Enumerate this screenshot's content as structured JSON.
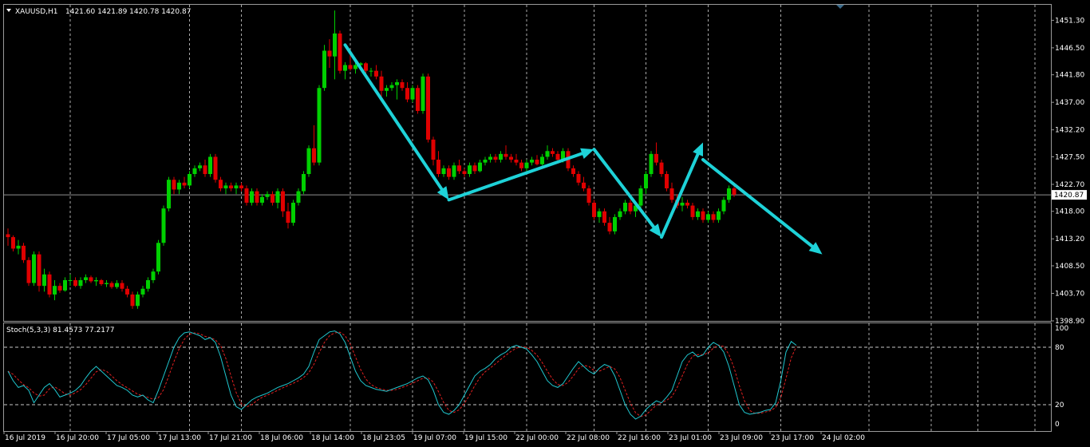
{
  "header": {
    "symbol": "XAUUSD,H1",
    "ohlc": "1421.60 1421.89 1420.78 1420.87",
    "menu_icon": "triangle-down-icon"
  },
  "indicator": {
    "label": "Stoch(5,3,3) 81.4573 77.2177"
  },
  "colors": {
    "background": "#000000",
    "bull": "#00d000",
    "bear": "#e00000",
    "grid": "#c8c8c8",
    "arrow": "#1ed2d8",
    "stoch_main": "#20c8d0",
    "stoch_signal": "#e02020",
    "bid_line": "#909090"
  },
  "chart_data": {
    "type": "candlestick",
    "timeframe": "H1",
    "ylim": [
      1398.9,
      1454.0
    ],
    "price_ticks": [
      "1451.30",
      "1446.50",
      "1441.80",
      "1437.00",
      "1432.20",
      "1427.50",
      "1422.70",
      "1418.00",
      "1413.20",
      "1408.50",
      "1403.70",
      "1398.90"
    ],
    "current_price": "1420.87",
    "time_labels": [
      "16 Jul 2019",
      "16 Jul 20:00",
      "17 Jul 05:00",
      "17 Jul 13:00",
      "17 Jul 21:00",
      "18 Jul 06:00",
      "18 Jul 14:00",
      "18 Jul 23:05",
      "19 Jul 07:00",
      "19 Jul 15:00",
      "22 Jul 00:00",
      "22 Jul 08:00",
      "22 Jul 16:00",
      "23 Jul 01:00",
      "23 Jul 09:00",
      "23 Jul 17:00",
      "24 Jul 02:00"
    ],
    "vertical_gridline_bars": [
      12,
      35,
      45,
      66,
      78,
      88,
      100,
      113,
      123,
      135,
      149,
      166,
      178,
      187,
      198
    ],
    "candles": [
      [
        1414.0,
        1415.0,
        1412.0,
        1413.5
      ],
      [
        1413.5,
        1413.8,
        1411.0,
        1411.5
      ],
      [
        1411.5,
        1413.0,
        1410.5,
        1412.0
      ],
      [
        1412.0,
        1412.5,
        1409.0,
        1409.5
      ],
      [
        1409.5,
        1410.0,
        1405.0,
        1405.5
      ],
      [
        1405.5,
        1411.0,
        1405.0,
        1410.5
      ],
      [
        1410.5,
        1411.0,
        1404.0,
        1405.0
      ],
      [
        1405.0,
        1408.0,
        1404.0,
        1407.0
      ],
      [
        1407.0,
        1407.5,
        1403.0,
        1403.5
      ],
      [
        1403.5,
        1406.0,
        1402.5,
        1405.0
      ],
      [
        1405.0,
        1405.5,
        1403.8,
        1404.2
      ],
      [
        1404.2,
        1406.5,
        1404.0,
        1406.0
      ],
      [
        1406.0,
        1407.0,
        1405.0,
        1406.0
      ],
      [
        1406.0,
        1406.5,
        1404.8,
        1405.0
      ],
      [
        1405.0,
        1406.5,
        1404.5,
        1406.0
      ],
      [
        1406.0,
        1407.0,
        1405.5,
        1406.5
      ],
      [
        1406.5,
        1406.8,
        1405.5,
        1405.8
      ],
      [
        1405.8,
        1406.5,
        1405.0,
        1406.0
      ],
      [
        1406.0,
        1406.2,
        1405.0,
        1405.3
      ],
      [
        1405.3,
        1406.0,
        1404.8,
        1405.5
      ],
      [
        1405.5,
        1405.8,
        1404.5,
        1404.8
      ],
      [
        1404.8,
        1406.0,
        1404.5,
        1405.5
      ],
      [
        1405.5,
        1406.0,
        1404.0,
        1404.5
      ],
      [
        1404.5,
        1405.0,
        1403.0,
        1403.5
      ],
      [
        1403.5,
        1404.0,
        1401.0,
        1401.5
      ],
      [
        1401.5,
        1404.0,
        1401.0,
        1403.5
      ],
      [
        1403.5,
        1405.0,
        1403.0,
        1404.5
      ],
      [
        1404.5,
        1406.5,
        1404.0,
        1406.0
      ],
      [
        1406.0,
        1408.0,
        1405.5,
        1407.5
      ],
      [
        1407.5,
        1413.0,
        1407.0,
        1412.5
      ],
      [
        1412.5,
        1419.0,
        1412.0,
        1418.5
      ],
      [
        1418.5,
        1424.0,
        1418.0,
        1423.5
      ],
      [
        1423.5,
        1424.0,
        1421.0,
        1421.8
      ],
      [
        1421.8,
        1423.5,
        1421.0,
        1423.0
      ],
      [
        1423.0,
        1424.0,
        1422.0,
        1422.5
      ],
      [
        1422.5,
        1425.0,
        1422.0,
        1424.5
      ],
      [
        1424.5,
        1426.0,
        1424.0,
        1425.5
      ],
      [
        1425.5,
        1426.5,
        1425.0,
        1426.0
      ],
      [
        1426.0,
        1427.0,
        1424.0,
        1424.5
      ],
      [
        1424.5,
        1428.0,
        1424.0,
        1427.5
      ],
      [
        1427.5,
        1428.0,
        1423.0,
        1423.5
      ],
      [
        1423.5,
        1424.0,
        1421.5,
        1422.0
      ],
      [
        1422.0,
        1423.0,
        1421.0,
        1422.5
      ],
      [
        1422.5,
        1423.0,
        1421.5,
        1422.0
      ],
      [
        1422.0,
        1423.0,
        1421.0,
        1422.5
      ],
      [
        1422.5,
        1423.0,
        1421.5,
        1422.0
      ],
      [
        1422.0,
        1422.5,
        1419.0,
        1419.5
      ],
      [
        1419.5,
        1422.0,
        1419.0,
        1421.5
      ],
      [
        1421.5,
        1422.0,
        1419.0,
        1419.5
      ],
      [
        1419.5,
        1421.0,
        1419.0,
        1420.5
      ],
      [
        1420.5,
        1421.5,
        1420.0,
        1421.0
      ],
      [
        1421.0,
        1421.5,
        1419.0,
        1419.5
      ],
      [
        1419.5,
        1422.0,
        1418.5,
        1421.5
      ],
      [
        1421.5,
        1422.0,
        1417.0,
        1418.0
      ],
      [
        1418.0,
        1419.5,
        1415.0,
        1416.0
      ],
      [
        1416.0,
        1420.0,
        1415.5,
        1419.5
      ],
      [
        1419.5,
        1422.0,
        1419.0,
        1421.5
      ],
      [
        1421.5,
        1425.0,
        1421.0,
        1424.5
      ],
      [
        1424.5,
        1429.5,
        1424.0,
        1429.0
      ],
      [
        1429.0,
        1433.0,
        1426.0,
        1426.5
      ],
      [
        1426.5,
        1440.0,
        1426.0,
        1439.5
      ],
      [
        1439.5,
        1447.0,
        1439.0,
        1446.0
      ],
      [
        1446.0,
        1448.0,
        1443.0,
        1445.0
      ],
      [
        1445.0,
        1453.0,
        1441.0,
        1449.0
      ],
      [
        1449.0,
        1449.5,
        1442.0,
        1442.5
      ],
      [
        1442.5,
        1444.0,
        1441.0,
        1443.5
      ],
      [
        1443.5,
        1446.0,
        1442.5,
        1442.8
      ],
      [
        1442.8,
        1444.0,
        1442.0,
        1443.5
      ],
      [
        1443.5,
        1444.0,
        1443.0,
        1443.8
      ],
      [
        1443.8,
        1444.0,
        1442.0,
        1442.5
      ],
      [
        1442.5,
        1443.0,
        1441.5,
        1442.5
      ],
      [
        1442.5,
        1443.5,
        1441.0,
        1441.5
      ],
      [
        1441.5,
        1442.5,
        1438.0,
        1439.0
      ],
      [
        1439.0,
        1440.0,
        1438.0,
        1439.5
      ],
      [
        1439.5,
        1440.5,
        1439.0,
        1440.0
      ],
      [
        1440.0,
        1441.0,
        1437.5,
        1440.5
      ],
      [
        1440.5,
        1441.0,
        1439.0,
        1439.5
      ],
      [
        1439.5,
        1440.5,
        1437.0,
        1437.5
      ],
      [
        1437.5,
        1440.0,
        1437.0,
        1439.5
      ],
      [
        1439.5,
        1440.0,
        1435.0,
        1435.5
      ],
      [
        1435.5,
        1442.0,
        1435.0,
        1441.5
      ],
      [
        1441.5,
        1442.0,
        1430.0,
        1430.5
      ],
      [
        1430.5,
        1431.0,
        1426.0,
        1427.0
      ],
      [
        1427.0,
        1428.5,
        1424.0,
        1424.5
      ],
      [
        1424.5,
        1426.0,
        1424.0,
        1425.5
      ],
      [
        1425.5,
        1426.0,
        1423.5,
        1424.0
      ],
      [
        1424.0,
        1426.5,
        1423.5,
        1426.0
      ],
      [
        1426.0,
        1427.0,
        1424.5,
        1425.0
      ],
      [
        1425.0,
        1425.5,
        1424.0,
        1424.5
      ],
      [
        1424.5,
        1426.5,
        1424.0,
        1426.0
      ],
      [
        1426.0,
        1426.5,
        1424.5,
        1425.0
      ],
      [
        1425.0,
        1427.0,
        1424.8,
        1426.5
      ],
      [
        1426.5,
        1427.5,
        1426.0,
        1427.0
      ],
      [
        1427.0,
        1428.0,
        1426.5,
        1427.5
      ],
      [
        1427.5,
        1428.0,
        1426.5,
        1427.0
      ],
      [
        1427.0,
        1428.5,
        1426.5,
        1428.0
      ],
      [
        1428.0,
        1429.5,
        1427.0,
        1427.5
      ],
      [
        1427.5,
        1428.0,
        1426.5,
        1427.0
      ],
      [
        1427.0,
        1428.0,
        1426.0,
        1426.5
      ],
      [
        1426.5,
        1427.0,
        1425.0,
        1425.5
      ],
      [
        1425.5,
        1427.0,
        1425.0,
        1426.5
      ],
      [
        1426.5,
        1427.5,
        1426.0,
        1427.0
      ],
      [
        1427.0,
        1427.8,
        1426.0,
        1426.2
      ],
      [
        1426.2,
        1428.0,
        1426.0,
        1427.5
      ],
      [
        1427.5,
        1429.5,
        1427.0,
        1428.5
      ],
      [
        1428.5,
        1429.0,
        1427.5,
        1428.0
      ],
      [
        1428.0,
        1428.5,
        1426.5,
        1427.0
      ],
      [
        1427.0,
        1429.0,
        1426.5,
        1428.5
      ],
      [
        1428.5,
        1429.0,
        1425.0,
        1425.5
      ],
      [
        1425.5,
        1426.0,
        1424.0,
        1424.5
      ],
      [
        1424.5,
        1425.0,
        1422.5,
        1423.0
      ],
      [
        1423.0,
        1424.0,
        1421.5,
        1422.0
      ],
      [
        1422.0,
        1422.5,
        1419.0,
        1419.5
      ],
      [
        1419.5,
        1420.0,
        1416.5,
        1417.0
      ],
      [
        1417.0,
        1418.5,
        1416.0,
        1418.0
      ],
      [
        1418.0,
        1418.5,
        1415.5,
        1416.0
      ],
      [
        1416.0,
        1417.0,
        1414.0,
        1414.5
      ],
      [
        1414.5,
        1417.5,
        1414.0,
        1417.0
      ],
      [
        1417.0,
        1418.5,
        1416.5,
        1418.0
      ],
      [
        1418.0,
        1420.0,
        1417.5,
        1419.5
      ],
      [
        1419.5,
        1420.0,
        1417.5,
        1418.0
      ],
      [
        1418.0,
        1419.5,
        1417.0,
        1419.0
      ],
      [
        1419.0,
        1422.5,
        1418.5,
        1422.0
      ],
      [
        1422.0,
        1425.0,
        1421.0,
        1424.5
      ],
      [
        1424.5,
        1428.5,
        1424.0,
        1428.0
      ],
      [
        1428.0,
        1430.0,
        1426.0,
        1426.5
      ],
      [
        1426.5,
        1427.0,
        1424.0,
        1424.5
      ],
      [
        1424.5,
        1425.0,
        1421.5,
        1422.0
      ],
      [
        1422.0,
        1423.0,
        1419.5,
        1420.0
      ],
      [
        1420.0,
        1421.0,
        1418.5,
        1419.0
      ],
      [
        1419.0,
        1420.5,
        1418.0,
        1419.5
      ],
      [
        1419.5,
        1420.0,
        1418.5,
        1419.0
      ],
      [
        1419.0,
        1419.5,
        1416.5,
        1417.0
      ],
      [
        1417.0,
        1418.5,
        1416.5,
        1418.0
      ],
      [
        1418.0,
        1418.5,
        1416.0,
        1416.5
      ],
      [
        1416.5,
        1418.0,
        1416.0,
        1417.5
      ],
      [
        1417.5,
        1418.0,
        1416.0,
        1416.5
      ],
      [
        1416.5,
        1418.5,
        1416.0,
        1418.0
      ],
      [
        1418.0,
        1420.5,
        1417.5,
        1420.0
      ],
      [
        1420.0,
        1422.5,
        1419.5,
        1422.0
      ],
      [
        1422.0,
        1422.8,
        1420.5,
        1420.9
      ]
    ],
    "annotation_arrows": [
      {
        "from_bar": 65,
        "from_price": 1447.0,
        "to_bar": 85,
        "to_price": 1420.0
      },
      {
        "from_bar": 85,
        "from_price": 1420.0,
        "to_bar": 113,
        "to_price": 1428.8
      },
      {
        "from_bar": 113,
        "from_price": 1428.8,
        "to_bar": 126,
        "to_price": 1413.5
      },
      {
        "from_bar": 126,
        "from_price": 1413.5,
        "to_bar": 134,
        "to_price": 1430.0
      },
      {
        "from_bar": 134,
        "from_price": 1427.0,
        "to_bar": 157,
        "to_price": 1410.5
      }
    ],
    "stochastic": {
      "params": "5,3,3",
      "main_value": "81.4573",
      "signal_value": "77.2177",
      "ticks": [
        "100",
        "80",
        "20",
        "0"
      ],
      "levels": [
        80,
        20
      ],
      "main": [
        55,
        45,
        38,
        40,
        35,
        22,
        30,
        38,
        42,
        36,
        28,
        30,
        32,
        35,
        40,
        48,
        55,
        60,
        55,
        50,
        45,
        40,
        38,
        35,
        30,
        28,
        30,
        25,
        22,
        35,
        50,
        65,
        80,
        90,
        95,
        96,
        94,
        92,
        88,
        90,
        85,
        70,
        50,
        30,
        18,
        15,
        20,
        25,
        28,
        30,
        32,
        35,
        38,
        40,
        42,
        45,
        48,
        52,
        60,
        75,
        88,
        92,
        96,
        97,
        94,
        85,
        70,
        55,
        45,
        40,
        38,
        36,
        35,
        34,
        36,
        38,
        40,
        42,
        45,
        48,
        50,
        46,
        35,
        20,
        12,
        10,
        14,
        20,
        30,
        40,
        50,
        55,
        58,
        62,
        68,
        72,
        75,
        80,
        82,
        80,
        78,
        72,
        65,
        55,
        45,
        40,
        38,
        42,
        50,
        58,
        65,
        60,
        55,
        52,
        58,
        62,
        60,
        50,
        35,
        20,
        10,
        5,
        8,
        15,
        20,
        24,
        22,
        28,
        35,
        50,
        65,
        72,
        75,
        70,
        72,
        80,
        85,
        82,
        75,
        60,
        40,
        20,
        12,
        10,
        11,
        12,
        14,
        15,
        22,
        45,
        75,
        86,
        82
      ]
    }
  }
}
